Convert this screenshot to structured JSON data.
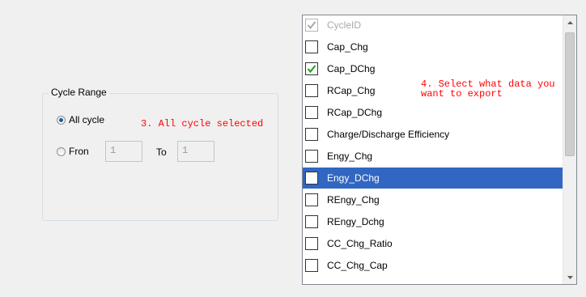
{
  "cycle_range": {
    "title": "Cycle Range",
    "all_cycle_label": "All cycle",
    "all_cycle_selected": true,
    "from_label": "Fron",
    "from_value": "1",
    "to_label": "To",
    "to_value": "1"
  },
  "annotations": {
    "step3": "3. All cycle selected",
    "step4_line1": "4. Select what data you",
    "step4_line2": "want to export"
  },
  "data_list": {
    "items": [
      {
        "label": "CycleID",
        "checked": true,
        "disabled": true,
        "selected": false
      },
      {
        "label": "Cap_Chg",
        "checked": false,
        "disabled": false,
        "selected": false
      },
      {
        "label": "Cap_DChg",
        "checked": true,
        "disabled": false,
        "selected": false
      },
      {
        "label": "RCap_Chg",
        "checked": false,
        "disabled": false,
        "selected": false
      },
      {
        "label": "RCap_DChg",
        "checked": false,
        "disabled": false,
        "selected": false
      },
      {
        "label": "Charge/Discharge Efficiency",
        "checked": false,
        "disabled": false,
        "selected": false
      },
      {
        "label": "Engy_Chg",
        "checked": false,
        "disabled": false,
        "selected": false
      },
      {
        "label": "Engy_DChg",
        "checked": false,
        "disabled": false,
        "selected": true
      },
      {
        "label": "REngy_Chg",
        "checked": false,
        "disabled": false,
        "selected": false
      },
      {
        "label": "REngy_Dchg",
        "checked": false,
        "disabled": false,
        "selected": false
      },
      {
        "label": "CC_Chg_Ratio",
        "checked": false,
        "disabled": false,
        "selected": false
      },
      {
        "label": "CC_Chg_Cap",
        "checked": false,
        "disabled": false,
        "selected": false
      }
    ]
  },
  "colors": {
    "selection": "#3166c2",
    "checkmark": "#1aa31a",
    "checkmark_disabled": "#a8a8a8",
    "annotation": "#ff0000"
  },
  "icons": {
    "scroll_up": "scroll-up-arrow-icon",
    "scroll_down": "scroll-down-arrow-icon",
    "check": "checkmark-icon"
  }
}
